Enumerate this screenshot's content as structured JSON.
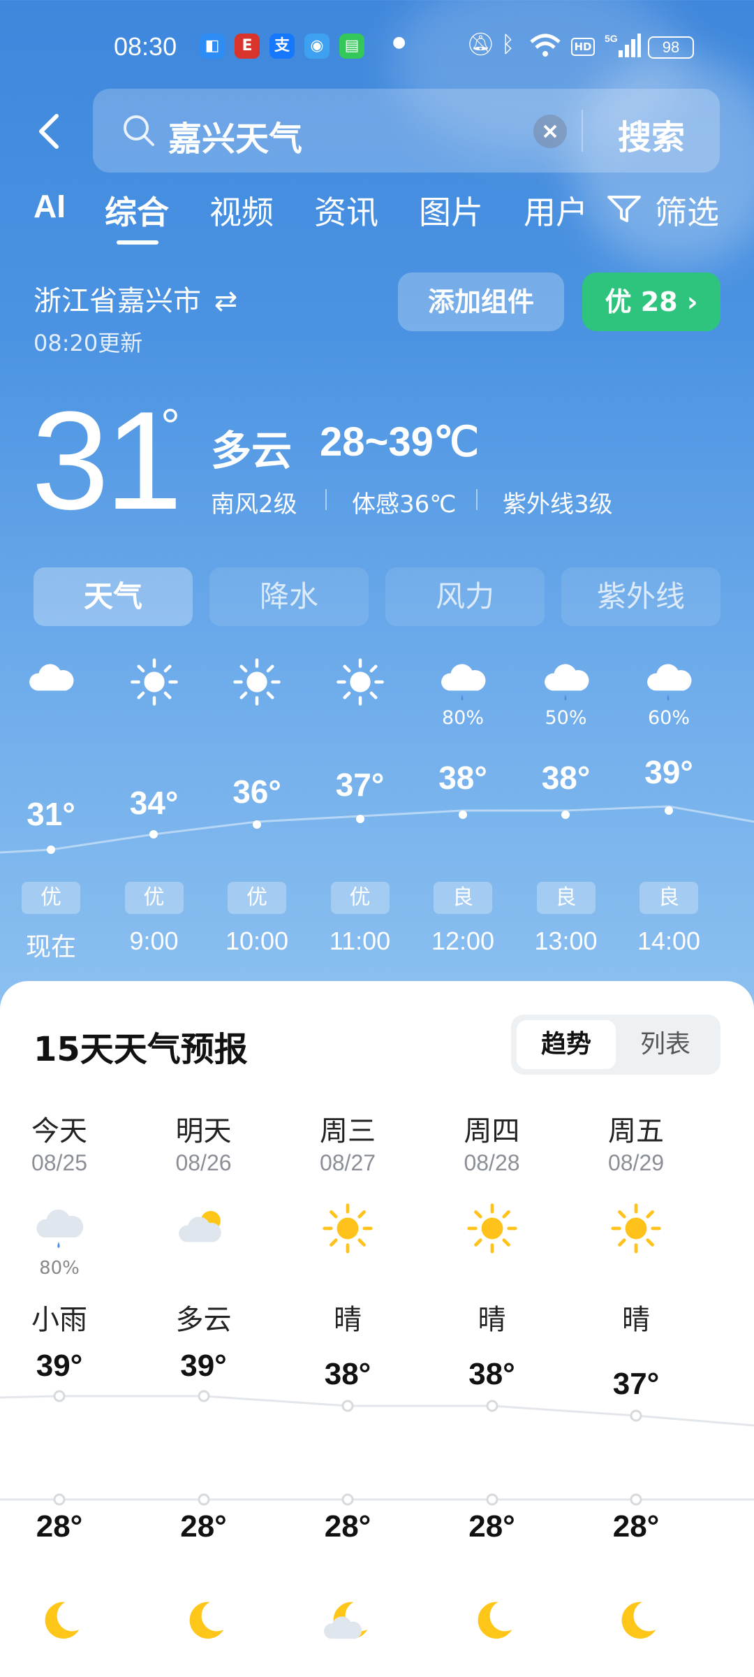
{
  "status_bar": {
    "time": "08:30",
    "app_icons": [
      {
        "icon": "browser-app-icon",
        "color": "#2e8df4",
        "glyph": "◧"
      },
      {
        "icon": "e-app-icon",
        "color": "#d8342c",
        "glyph": "E"
      },
      {
        "icon": "alipay-app-icon",
        "color": "#1677ff",
        "glyph": "支"
      },
      {
        "icon": "map-app-icon",
        "color": "#3ea0f0",
        "glyph": "◉"
      },
      {
        "icon": "message-app-icon",
        "color": "#34c759",
        "glyph": "▤"
      }
    ],
    "battery": "98"
  },
  "search": {
    "query": "嘉兴天气",
    "button_label": "搜索"
  },
  "tabs": [
    {
      "label": "AI",
      "active": false
    },
    {
      "label": "综合",
      "active": true
    },
    {
      "label": "视频",
      "active": false
    },
    {
      "label": "资讯",
      "active": false
    },
    {
      "label": "图片",
      "active": false
    },
    {
      "label": "用户",
      "active": false
    },
    {
      "label": "筛选",
      "active": false
    }
  ],
  "location": {
    "name": "浙江省嘉兴市",
    "update_time": "08:20更新"
  },
  "add_widget_label": "添加组件",
  "aqi": {
    "label": "优 28",
    "color": "#2ec47d"
  },
  "current": {
    "temp": "31",
    "degree": "°",
    "condition": "多云",
    "range": "28~39℃",
    "wind": "南风2级",
    "feels_like": "体感36℃",
    "uv": "紫外线3级"
  },
  "segments": [
    {
      "label": "天气",
      "active": true
    },
    {
      "label": "降水",
      "active": false
    },
    {
      "label": "风力",
      "active": false
    },
    {
      "label": "紫外线",
      "active": false
    }
  ],
  "hourly": [
    {
      "time": "现在",
      "temp": "31°",
      "aqi": "优",
      "icon": "cloud-icon",
      "prob": ""
    },
    {
      "time": "9:00",
      "temp": "34°",
      "aqi": "优",
      "icon": "sun-icon",
      "prob": ""
    },
    {
      "time": "10:00",
      "temp": "36°",
      "aqi": "优",
      "icon": "sun-icon",
      "prob": ""
    },
    {
      "time": "11:00",
      "temp": "37°",
      "aqi": "优",
      "icon": "sun-icon",
      "prob": ""
    },
    {
      "time": "12:00",
      "temp": "38°",
      "aqi": "良",
      "icon": "rain-cloud-icon",
      "prob": "80%"
    },
    {
      "time": "13:00",
      "temp": "38°",
      "aqi": "良",
      "icon": "rain-cloud-icon",
      "prob": "50%"
    },
    {
      "time": "14:00",
      "temp": "39°",
      "aqi": "良",
      "icon": "rain-cloud-icon",
      "prob": "60%"
    }
  ],
  "forecast": {
    "title": "15天天气预报",
    "toggle_trend": "趋势",
    "toggle_list": "列表",
    "days": [
      {
        "day": "今天",
        "date": "08/25",
        "icon": "rain-cloud-icon",
        "prob": "80%",
        "condition": "小雨",
        "high": "39°",
        "low": "28°",
        "night_icon": "moon-icon"
      },
      {
        "day": "明天",
        "date": "08/26",
        "icon": "partly-cloudy-icon",
        "prob": "",
        "condition": "多云",
        "high": "39°",
        "low": "28°",
        "night_icon": "moon-icon"
      },
      {
        "day": "周三",
        "date": "08/27",
        "icon": "sun-icon",
        "prob": "",
        "condition": "晴",
        "high": "38°",
        "low": "28°",
        "night_icon": "cloudy-moon-icon"
      },
      {
        "day": "周四",
        "date": "08/28",
        "icon": "sun-icon",
        "prob": "",
        "condition": "晴",
        "high": "38°",
        "low": "28°",
        "night_icon": "moon-icon"
      },
      {
        "day": "周五",
        "date": "08/29",
        "icon": "sun-icon",
        "prob": "",
        "condition": "晴",
        "high": "37°",
        "low": "28°",
        "night_icon": "moon-icon"
      }
    ]
  }
}
